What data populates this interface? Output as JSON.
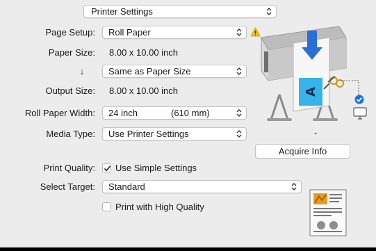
{
  "presets_popup": {
    "value": "Printer Settings"
  },
  "page_setup": {
    "label": "Page Setup:",
    "value": "Roll Paper"
  },
  "paper_size": {
    "label": "Paper Size:",
    "value": "8.00 x 10.00 inch"
  },
  "scaling": {
    "arrow": "↓",
    "value": "Same as Paper Size"
  },
  "output_size": {
    "label": "Output Size:",
    "value": "8.00 x 10.00 inch"
  },
  "roll_paper_width": {
    "label": "Roll Paper Width:",
    "value_inch": "24 inch",
    "value_mm": "(610 mm)"
  },
  "media_type": {
    "label": "Media Type:",
    "value": "Use Printer Settings"
  },
  "status_dash": "-",
  "acquire_info": {
    "label": "Acquire Info"
  },
  "print_quality": {
    "label": "Print Quality:",
    "checkbox_label": "Use Simple Settings",
    "checked": true
  },
  "select_target": {
    "label": "Select Target:",
    "value": "Standard"
  },
  "high_quality": {
    "checkbox_label": "Print with High Quality",
    "checked": false
  },
  "colors": {
    "panel_bg": "#ececec",
    "warning": "#f2c200",
    "accent_blue": "#1a73d9",
    "arrow_blue": "#2a6fd4",
    "paper_cyan": "#35b3ea"
  },
  "icons": [
    "chevron-updown-icon",
    "warning-icon",
    "printer-illustration",
    "checkmark-badge-icon",
    "monitor-icon",
    "quality-preview-icon"
  ]
}
